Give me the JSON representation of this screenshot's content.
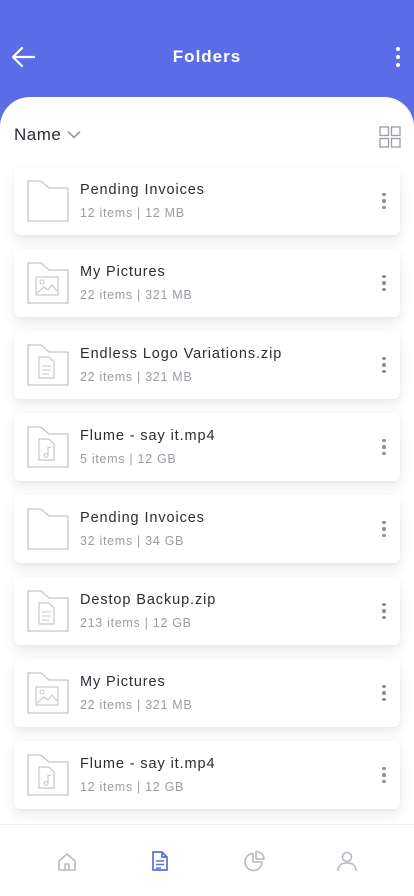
{
  "header": {
    "title": "Folders",
    "background_color": "#5A6DE6",
    "back_icon": "arrow-left-icon",
    "menu_icon": "kebab-vertical-icon"
  },
  "sort": {
    "label": "Name",
    "icon": "chevron-down-icon",
    "view_toggle_icon": "grid-view-icon"
  },
  "folders": [
    {
      "name": "Pending Invoices",
      "meta": "12 items | 12 MB",
      "icon": "folder-icon"
    },
    {
      "name": "My Pictures",
      "meta": "22 items | 321 MB",
      "icon": "image-file-icon"
    },
    {
      "name": "Endless Logo Variations.zip",
      "meta": "22 items | 321 MB",
      "icon": "document-file-icon"
    },
    {
      "name": "Flume - say it.mp4",
      "meta": "5 items | 12 GB",
      "icon": "music-file-icon"
    },
    {
      "name": "Pending Invoices",
      "meta": "32 items | 34 GB",
      "icon": "folder-icon"
    },
    {
      "name": "Destop Backup.zip",
      "meta": "213 items | 12 GB",
      "icon": "document-file-icon"
    },
    {
      "name": "My Pictures",
      "meta": "22 items | 321 MB",
      "icon": "image-file-icon"
    },
    {
      "name": "Flume - say it.mp4",
      "meta": "12 items | 12 GB",
      "icon": "music-file-icon"
    }
  ],
  "bottom_nav": {
    "items": [
      {
        "icon": "home-icon",
        "active": false
      },
      {
        "icon": "file-icon",
        "active": true
      },
      {
        "icon": "pie-chart-icon",
        "active": false
      },
      {
        "icon": "user-icon",
        "active": false
      }
    ],
    "active_color": "#5A6DE6",
    "inactive_color": "#B8BAC2"
  }
}
